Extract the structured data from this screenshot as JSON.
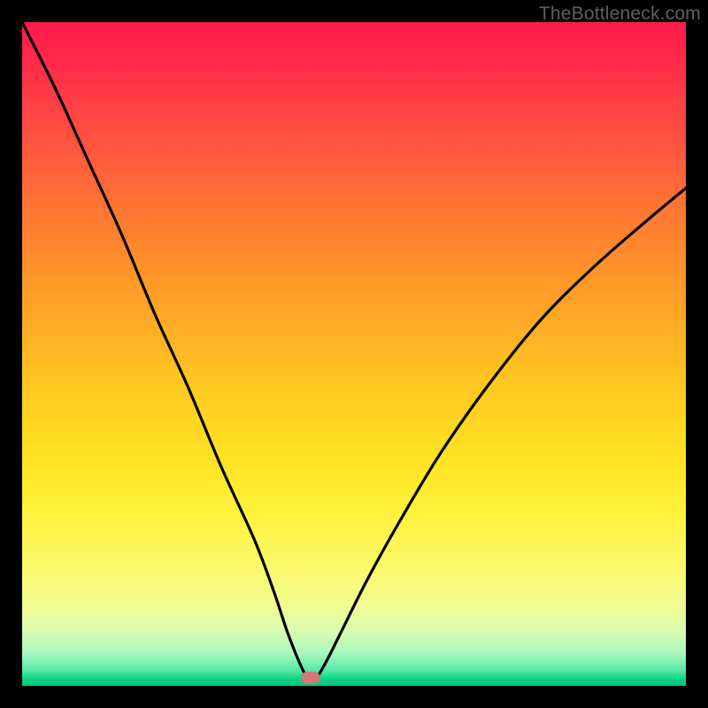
{
  "watermark": "TheBottleneck.com",
  "marker": {
    "x_frac": 0.435,
    "y_frac": 0.988
  },
  "chart_data": {
    "type": "line",
    "title": "",
    "xlabel": "",
    "ylabel": "",
    "xlim": [
      0,
      100
    ],
    "ylim": [
      0,
      100
    ],
    "series": [
      {
        "name": "bottleneck-curve",
        "x": [
          0,
          5,
          10,
          15,
          20,
          25,
          30,
          35,
          38,
          40,
          42,
          43,
          43.5,
          44.5,
          46,
          48,
          52,
          57,
          63,
          70,
          78,
          86,
          94,
          100
        ],
        "y": [
          100,
          90,
          79,
          68,
          56,
          45,
          33,
          22,
          14,
          8,
          3,
          1.2,
          0.6,
          1.4,
          4,
          8,
          16,
          25,
          35,
          45,
          55,
          63,
          70,
          75
        ]
      }
    ],
    "annotations": [
      {
        "type": "marker",
        "x": 43.5,
        "y": 1.2,
        "label": "optimal-point"
      }
    ]
  }
}
